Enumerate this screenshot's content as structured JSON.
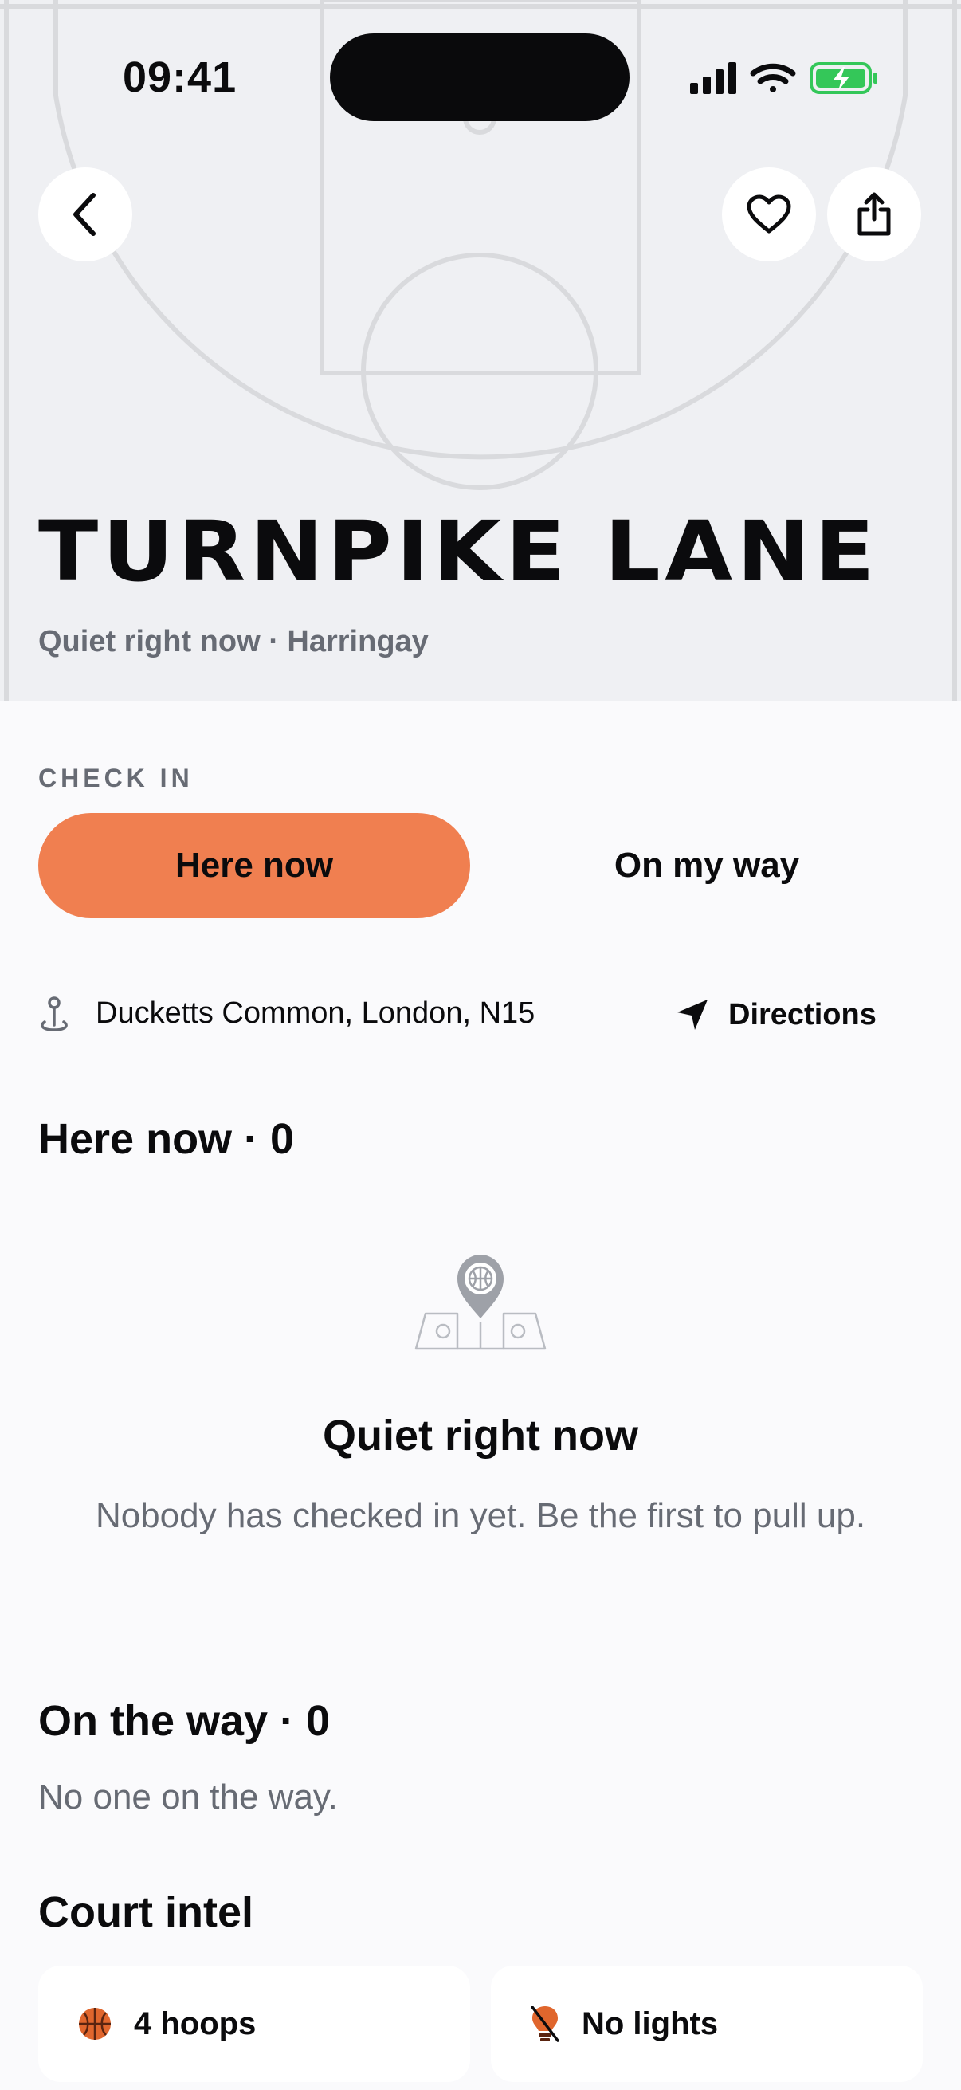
{
  "status_bar": {
    "time": "09:41"
  },
  "hero": {
    "title": "TURNPIKE LANE",
    "subtitle": "Quiet right now · Harringay"
  },
  "check_in": {
    "label": "CHECK IN",
    "here_now": "Here now",
    "on_my_way": "On my way"
  },
  "location": {
    "address": "Ducketts Common, London, N15",
    "directions": "Directions"
  },
  "here_now": {
    "heading": "Here now · 0",
    "empty_title": "Quiet right now",
    "empty_body": "Nobody has checked in yet. Be the first to pull up."
  },
  "on_the_way": {
    "heading": "On the way · 0",
    "empty_text": "No one on the way."
  },
  "court_intel": {
    "heading": "Court intel",
    "items": [
      {
        "icon": "basketball-icon",
        "label": "4 hoops"
      },
      {
        "icon": "no-lights-icon",
        "label": "No lights"
      }
    ]
  },
  "colors": {
    "accent": "#f07f50",
    "hero_bg": "#eff0f3",
    "muted_text": "#676b74",
    "battery": "#34c759"
  }
}
